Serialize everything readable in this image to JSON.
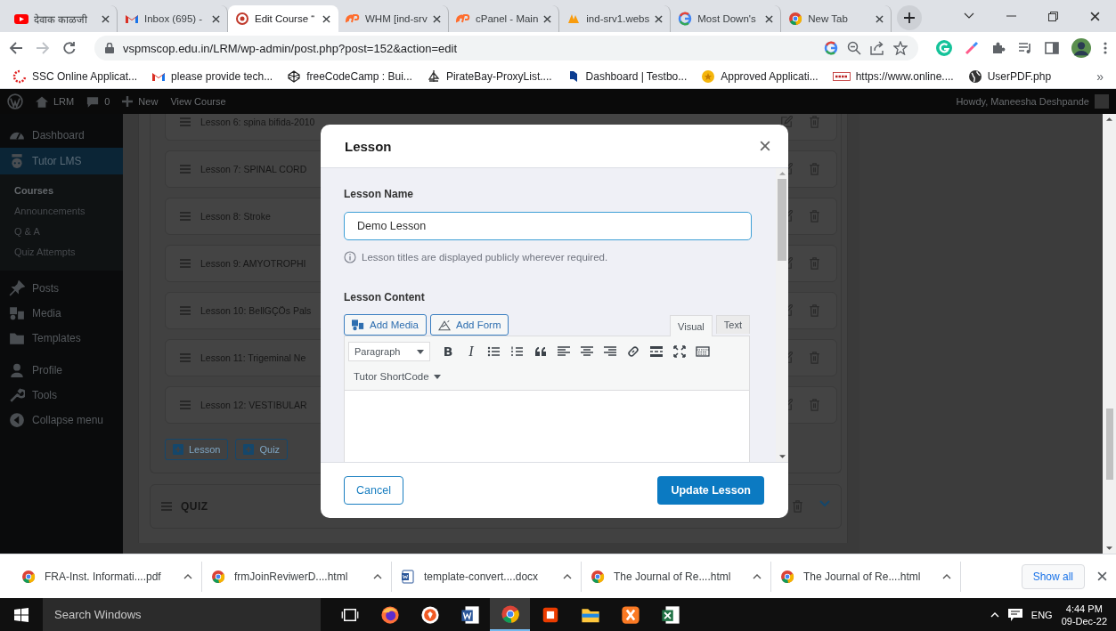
{
  "browser": {
    "tabs": [
      {
        "kind": "youtube",
        "title": "देवाक काळजी",
        "selected": false
      },
      {
        "kind": "gmail",
        "title": "Inbox (695) -",
        "selected": false
      },
      {
        "kind": "tutor",
        "title": "Edit Course “",
        "selected": true
      },
      {
        "kind": "cpanel",
        "title": "WHM [ind-srv",
        "selected": false
      },
      {
        "kind": "cpanel",
        "title": "cPanel - Main",
        "selected": false
      },
      {
        "kind": "pma",
        "title": "ind-srv1.webs",
        "selected": false
      },
      {
        "kind": "google",
        "title": "Most Down's",
        "selected": false
      },
      {
        "kind": "chrome",
        "title": "New Tab",
        "selected": false
      }
    ],
    "address": "vspmscop.edu.in/LRM/wp-admin/post.php?post=152&action=edit",
    "bookmarks": [
      {
        "kind": "ssc",
        "label": "SSC Online Applicat..."
      },
      {
        "kind": "gmail",
        "label": "please provide tech..."
      },
      {
        "kind": "codepen",
        "label": "freeCodeCamp : Bui..."
      },
      {
        "kind": "pirate",
        "label": "PirateBay-ProxyList...."
      },
      {
        "kind": "testbook",
        "label": "Dashboard | Testbo..."
      },
      {
        "kind": "coin",
        "label": "Approved Applicati..."
      },
      {
        "kind": "nsdl",
        "label": "https://www.online...."
      },
      {
        "kind": "globe",
        "label": "UserPDF.php"
      }
    ],
    "more_bookmarks": "»"
  },
  "admin_bar": {
    "site": "LRM",
    "comments": "0",
    "new": "New",
    "view": "View Course",
    "greeting": "Howdy, Maneesha Deshpande"
  },
  "sidebar": [
    {
      "kind": "dashboard",
      "label": "Dashboard",
      "selected": false
    },
    {
      "kind": "tutor",
      "label": "Tutor LMS",
      "selected": true,
      "children": [
        {
          "label": "Courses",
          "selected": true
        },
        {
          "label": "Announcements",
          "selected": false
        },
        {
          "label": "Q & A",
          "selected": false
        },
        {
          "label": "Quiz Attempts",
          "selected": false
        }
      ]
    },
    {
      "kind": "posts",
      "label": "Posts",
      "selected": false
    },
    {
      "kind": "media",
      "label": "Media",
      "selected": false
    },
    {
      "kind": "templates",
      "label": "Templates",
      "selected": false
    },
    {
      "kind": "profile",
      "label": "Profile",
      "selected": false
    },
    {
      "kind": "tools",
      "label": "Tools",
      "selected": false
    },
    {
      "kind": "collapse",
      "label": "Collapse menu",
      "selected": false
    }
  ],
  "course_builder": {
    "lessons": [
      "Lesson 6: spina bifida-2010",
      "Lesson 7: SPINAL CORD",
      "Lesson 8: Stroke",
      "Lesson 9: AMYOTROPHI",
      "Lesson 10: BellGÇÖs Pals",
      "Lesson 11: Trigeminal Ne",
      "Lesson 12: VESTIBULAR"
    ],
    "add_buttons": [
      "Lesson",
      "Quiz"
    ],
    "quiz_title": "QUIZ"
  },
  "modal": {
    "title": "Lesson",
    "name_label": "Lesson Name",
    "name_value": "Demo Lesson",
    "hint": "Lesson titles are displayed publicly wherever required.",
    "content_label": "Lesson Content",
    "media_buttons": [
      {
        "kind": "media",
        "label": "Add Media"
      },
      {
        "kind": "form",
        "label": "Add Form"
      }
    ],
    "editor_tabs": [
      {
        "label": "Visual",
        "selected": true
      },
      {
        "label": "Text",
        "selected": false
      }
    ],
    "format": "Paragraph",
    "toolbar": [
      {
        "kind": "bold",
        "label": "B"
      },
      {
        "kind": "italic",
        "label": "I"
      },
      {
        "kind": "bullets"
      },
      {
        "kind": "numbers"
      },
      {
        "kind": "quote"
      },
      {
        "kind": "align-left"
      },
      {
        "kind": "align-center"
      },
      {
        "kind": "align-right"
      },
      {
        "kind": "link"
      },
      {
        "kind": "more"
      },
      {
        "kind": "fullscreen"
      },
      {
        "kind": "kitchen-sink"
      }
    ],
    "shortcode": "Tutor ShortCode",
    "cancel": "Cancel",
    "submit": "Update Lesson"
  },
  "downloads": {
    "items": [
      {
        "kind": "chrome",
        "name": "FRA-Inst. Informati....pdf"
      },
      {
        "kind": "chrome",
        "name": "frmJoinReviwerD....html"
      },
      {
        "kind": "word",
        "name": "template-convert....docx"
      },
      {
        "kind": "chrome",
        "name": "The Journal of Re....html"
      },
      {
        "kind": "chrome",
        "name": "The Journal of Re....html"
      }
    ],
    "show_all": "Show all"
  },
  "taskbar": {
    "search": "Search Windows",
    "apps": [
      {
        "kind": "task-view",
        "selected": false
      },
      {
        "kind": "firefox",
        "selected": false
      },
      {
        "kind": "brave",
        "selected": false
      },
      {
        "kind": "word",
        "selected": false
      },
      {
        "kind": "chrome",
        "selected": true
      },
      {
        "kind": "office",
        "selected": false
      },
      {
        "kind": "explorer",
        "selected": false
      },
      {
        "kind": "xampp",
        "selected": false
      },
      {
        "kind": "excel",
        "selected": false
      }
    ],
    "language": "ENG",
    "time": "4:44 PM",
    "date": "09-Dec-22"
  }
}
